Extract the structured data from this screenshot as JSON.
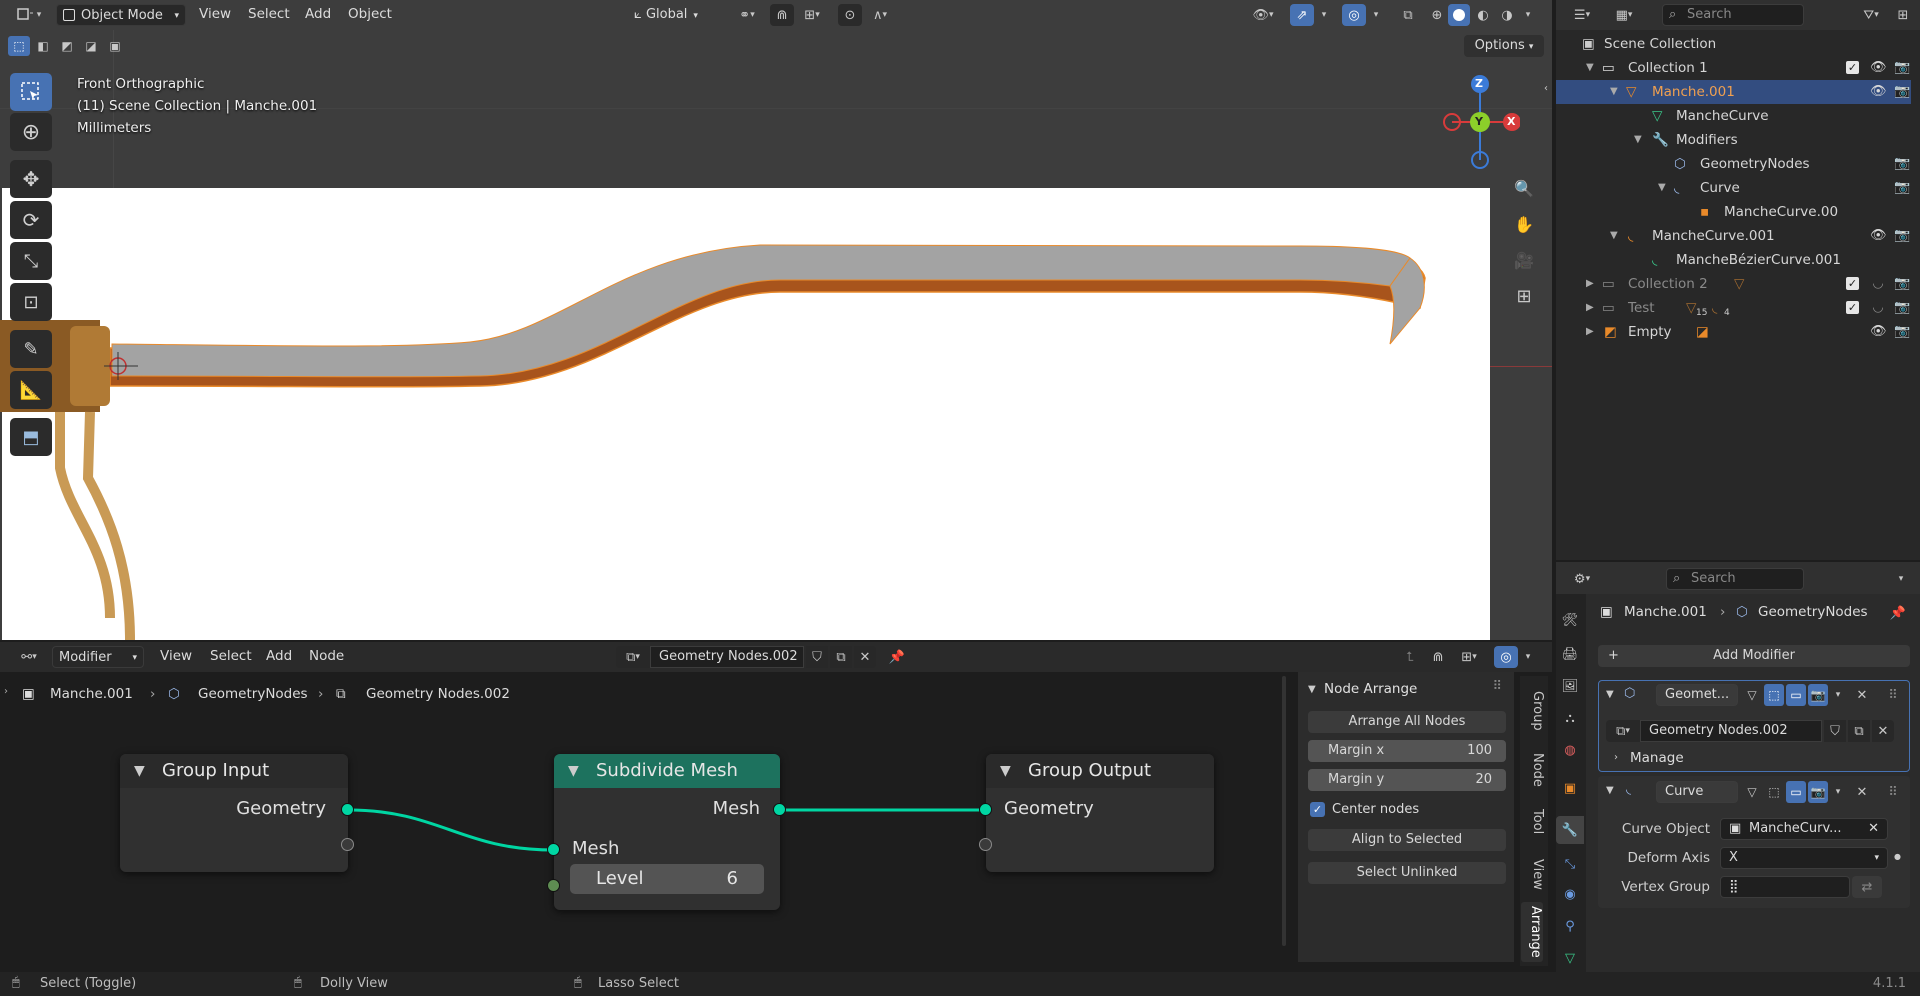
{
  "viewport_header": {
    "mode": "Object Mode",
    "menus": [
      "View",
      "Select",
      "Add",
      "Object"
    ],
    "orientation": "Global",
    "options": "Options"
  },
  "viewport_info": {
    "view_name": "Front Orthographic",
    "collection_line": "(11) Scene Collection | Manche.001",
    "units": "Millimeters"
  },
  "gizmo": {
    "z": "Z",
    "y": "Y",
    "x": "X"
  },
  "outliner": {
    "search_placeholder": "Search",
    "rows": [
      {
        "label": "Scene Collection"
      },
      {
        "label": "Collection 1"
      },
      {
        "label": "Manche.001"
      },
      {
        "label": "MancheCurve"
      },
      {
        "label": "Modifiers"
      },
      {
        "label": "GeometryNodes"
      },
      {
        "label": "Curve"
      },
      {
        "label": "MancheCurve.00"
      },
      {
        "label": "MancheCurve.001"
      },
      {
        "label": "MancheBézierCurve.001"
      },
      {
        "label": "Collection 2"
      },
      {
        "label": "Test"
      },
      {
        "label": "Empty"
      }
    ],
    "test_badges": {
      "a": "15",
      "b": "4"
    }
  },
  "node_header": {
    "editor": "Modifier",
    "menus": [
      "View",
      "Select",
      "Add",
      "Node"
    ],
    "tree_name": "Geometry Nodes.002"
  },
  "node_breadcrumb": {
    "a": "Manche.001",
    "b": "GeometryNodes",
    "c": "Geometry Nodes.002"
  },
  "nodes": {
    "group_input": {
      "title": "Group Input",
      "out": "Geometry"
    },
    "subdivide": {
      "title": "Subdivide Mesh",
      "out": "Mesh",
      "in": "Mesh",
      "level_label": "Level",
      "level_value": "6"
    },
    "group_output": {
      "title": "Group Output",
      "in": "Geometry"
    }
  },
  "arrange_panel": {
    "title": "Node Arrange",
    "arrange_all": "Arrange All Nodes",
    "margin_x_label": "Margin x",
    "margin_x": "100",
    "margin_y_label": "Margin y",
    "margin_y": "20",
    "center_nodes": "Center nodes",
    "align_selected": "Align to Selected",
    "select_unlinked": "Select Unlinked"
  },
  "side_tabs": [
    "Group",
    "Node",
    "Tool",
    "View",
    "Arrange"
  ],
  "properties": {
    "search_placeholder": "Search",
    "breadcrumb_obj": "Manche.001",
    "breadcrumb_mod": "GeometryNodes",
    "add_modifier": "Add Modifier",
    "gn_name": "Geomet...",
    "gn_tree": "Geometry Nodes.002",
    "manage": "Manage",
    "curve_name": "Curve",
    "curve_object_label": "Curve Object",
    "curve_object_value": "MancheCurv...",
    "deform_axis_label": "Deform Axis",
    "deform_axis_value": "X",
    "vertex_group_label": "Vertex Group"
  },
  "status_bar": {
    "select": "Select (Toggle)",
    "dolly": "Dolly View",
    "lasso": "Lasso Select",
    "version": "4.1.1"
  },
  "colors": {
    "accent_blue": "#4772b3",
    "socket_geometry": "#00d6a3",
    "subdivide_header": "#1d725e",
    "object_orange": "#e98a2a"
  }
}
